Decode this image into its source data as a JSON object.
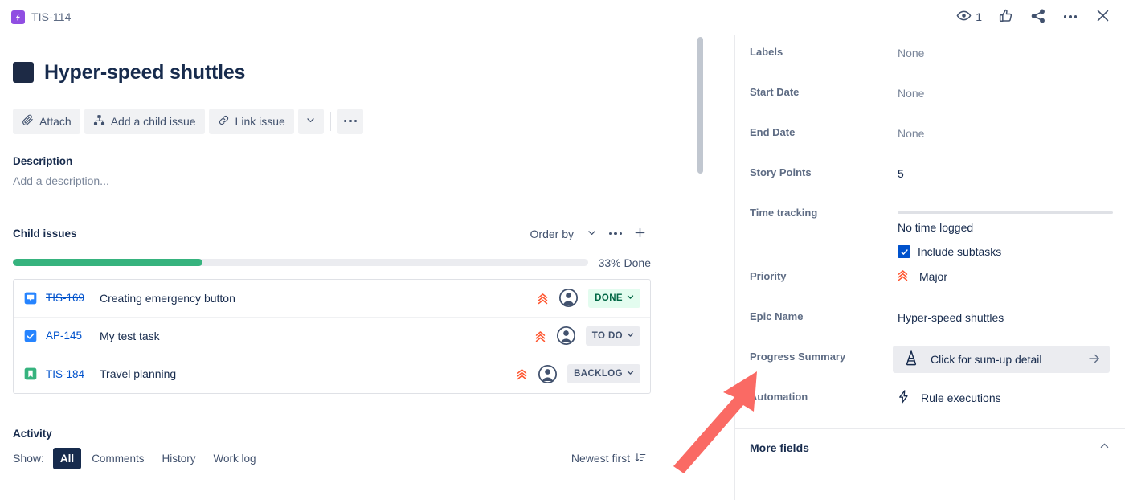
{
  "topbar": {
    "issue_key": "TIS-114",
    "epic_icon": "epic-icon",
    "watch_icon": "eye-icon",
    "watch_count": "1",
    "like_icon": "thumbs-up-icon",
    "share_icon": "share-icon",
    "more_icon": "more-horizontal-icon",
    "close_icon": "close-icon"
  },
  "issue": {
    "title": "Hyper-speed shuttles",
    "toolbar": {
      "attach_label": "Attach",
      "attach_icon": "paperclip-icon",
      "add_child_label": "Add a child issue",
      "add_child_icon": "child-issue-icon",
      "link_issue_label": "Link issue",
      "link_issue_icon": "link-icon",
      "more_chevron_icon": "chevron-down-icon",
      "more_actions_icon": "more-horizontal-icon"
    },
    "description": {
      "heading": "Description",
      "placeholder": "Add a description..."
    }
  },
  "child_issues": {
    "heading": "Child issues",
    "order_by_label": "Order by",
    "order_by_chevron_icon": "chevron-down-icon",
    "more_icon": "more-horizontal-icon",
    "add_icon": "plus-icon",
    "progress_percent": 33,
    "progress_label": "33% Done",
    "progress_color": "#36b37e",
    "items": [
      {
        "type_icon": "story-icon",
        "type_color": "#2684ff",
        "key": "TIS-169",
        "key_struck": true,
        "summary": "Creating emergency button",
        "priority_icon": "priority-major-icon",
        "has_priority": true,
        "assignee_icon": "avatar-icon",
        "status": "DONE",
        "status_style": "done",
        "status_chevron_icon": "chevron-down-icon"
      },
      {
        "type_icon": "task-icon",
        "type_color": "#2684ff",
        "key": "AP-145",
        "key_struck": false,
        "summary": "My test task",
        "priority_icon": "priority-major-icon",
        "has_priority": true,
        "assignee_icon": "avatar-icon",
        "status": "TO DO",
        "status_style": "todo",
        "status_chevron_icon": "chevron-down-icon"
      },
      {
        "type_icon": "story-icon",
        "type_color": "#36b37e",
        "key": "TIS-184",
        "key_struck": false,
        "summary": "Travel planning",
        "priority_icon": "priority-major-icon",
        "has_priority": true,
        "assignee_icon": "avatar-icon",
        "status": "BACKLOG",
        "status_style": "backlog",
        "status_chevron_icon": "chevron-down-icon"
      }
    ]
  },
  "activity": {
    "heading": "Activity",
    "show_label": "Show:",
    "tabs": [
      {
        "label": "All",
        "active": true
      },
      {
        "label": "Comments",
        "active": false
      },
      {
        "label": "History",
        "active": false
      },
      {
        "label": "Work log",
        "active": false
      }
    ],
    "sort_label": "Newest first",
    "sort_icon": "sort-descending-icon"
  },
  "details": {
    "fields": [
      {
        "label": "Labels",
        "value": "None",
        "muted": true
      },
      {
        "label": "Start Date",
        "value": "None",
        "muted": true
      },
      {
        "label": "End Date",
        "value": "None",
        "muted": true
      },
      {
        "label": "Story Points",
        "value": "5",
        "muted": false
      }
    ],
    "time_tracking": {
      "label": "Time tracking",
      "value": "No time logged",
      "include_subtasks_label": "Include subtasks",
      "include_subtasks_checked": true,
      "check_icon": "checkmark-icon"
    },
    "priority": {
      "label": "Priority",
      "value": "Major",
      "icon": "priority-major-icon",
      "color": "#ff5630"
    },
    "epic_name": {
      "label": "Epic Name",
      "value": "Hyper-speed shuttles"
    },
    "progress_summary": {
      "label": "Progress Summary",
      "button_text": "Click for sum-up detail",
      "app_icon": "cone-app-icon",
      "arrow_icon": "arrow-right-icon"
    },
    "automation": {
      "label": "Automation",
      "value": "Rule executions",
      "icon": "lightning-bolt-icon"
    },
    "more_fields": {
      "label": "More fields",
      "chevron_icon": "chevron-up-icon"
    }
  },
  "annotation": {
    "arrow_icon": "red-pointer-arrow",
    "color": "#fa6a64"
  }
}
